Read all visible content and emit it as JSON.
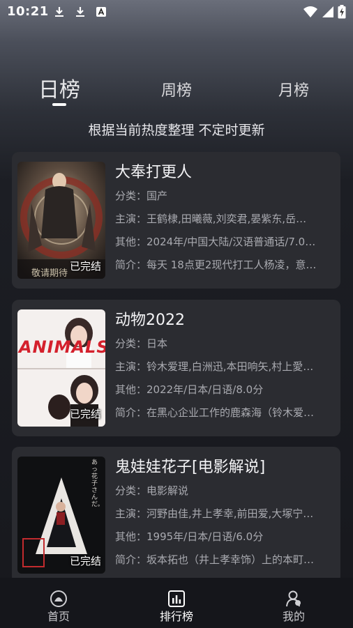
{
  "status_bar": {
    "time": "10:21",
    "icons": [
      "download-icon",
      "download-icon",
      "a-icon",
      "wifi-icon",
      "signal-icon",
      "battery-charging-icon"
    ]
  },
  "tabs": [
    {
      "label": "日榜",
      "active": true
    },
    {
      "label": "周榜",
      "active": false
    },
    {
      "label": "月榜",
      "active": false
    }
  ],
  "subtitle": "根据当前热度整理 不定时更新",
  "items": [
    {
      "title": "大奉打更人",
      "category": "分类：国产",
      "cast": "主演：王鹤棣,田曦薇,刘奕君,晏紫东,岳…",
      "other": "其他：2024年/中国大陆/汉语普通话/7.0…",
      "intro": "简介：每天 18点更2现代打工人杨凌，意…",
      "badge": "已完结",
      "poster_text": "敬请期待"
    },
    {
      "title": "动物2022",
      "category": "分类：日本",
      "cast": "主演：铃木爱理,白洲迅,本田响矢,村上愛…",
      "other": "其他：2022年/日本/日语/8.0分",
      "intro": "简介：在黑心企业工作的鹿森海（铃木爱…",
      "badge": "已完结",
      "poster_text": "ANIMALS"
    },
    {
      "title": "鬼娃娃花子[电影解说]",
      "category": "分类：电影解说",
      "cast": "主演：河野由佳,井上孝幸,前田爱,大塚宁…",
      "other": "其他：1995年/日本/日语/6.0分",
      "intro": "简介：坂本拓也（井上孝幸饰）上的本町…",
      "badge": "已完结",
      "poster_text": "あっ 花子さんだ。"
    }
  ],
  "bottom_nav": [
    {
      "label": "首页",
      "icon": "home-icon",
      "active": false
    },
    {
      "label": "排行榜",
      "icon": "ranking-icon",
      "active": true
    },
    {
      "label": "我的",
      "icon": "profile-icon",
      "active": false
    }
  ]
}
